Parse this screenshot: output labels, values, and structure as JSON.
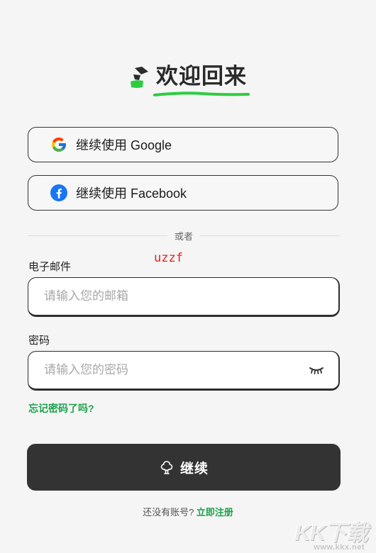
{
  "header": {
    "title": "欢迎回来",
    "logo_icon": "brand-logo-icon",
    "accent_color": "#2ecc40"
  },
  "social": {
    "google_label": "继续使用 Google",
    "facebook_label": "继续使用 Facebook"
  },
  "divider": {
    "text": "或者"
  },
  "watermark_text": "uzzf",
  "form": {
    "email_label": "电子邮件",
    "email_placeholder": "请输入您的邮箱",
    "email_value": "",
    "password_label": "密码",
    "password_placeholder": "请输入您的密码",
    "password_value": "",
    "forgot_label": "忘记密码了吗?"
  },
  "continue_button": {
    "label": "继续",
    "icon": "tree-icon",
    "color": "#333333"
  },
  "signup": {
    "prompt": "还没有账号?",
    "link_label": "立即注册",
    "link_color": "#1aa34a"
  },
  "site_logo": {
    "brand": "KK下载",
    "url": "www.kkx.net"
  }
}
